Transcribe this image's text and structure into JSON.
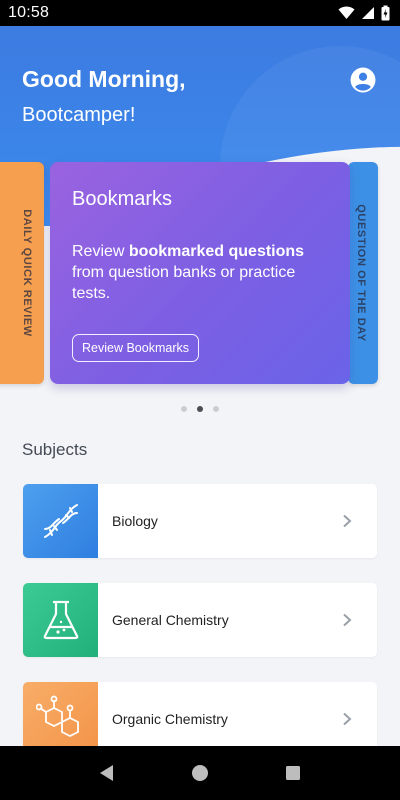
{
  "status": {
    "time": "10:58",
    "icons": [
      "wifi-icon",
      "signal-icon",
      "battery-charging-icon"
    ]
  },
  "header": {
    "greeting": "Good Morning,",
    "name": "Bootcamper!",
    "profile_icon": "account-circle-icon"
  },
  "carousel": {
    "left_card_label": "DAILY QUICK REVIEW",
    "main_card": {
      "title": "Bookmarks",
      "desc_part1": "Review ",
      "desc_bold1": "bookmarked questions",
      "desc_part2": " from question banks or practice tests.",
      "button_label": "Review Bookmarks"
    },
    "right_card_label": "QUESTION OF THE DAY",
    "page_count": 3,
    "active_index": 1
  },
  "subjects": {
    "title": "Subjects",
    "items": [
      {
        "label": "Biology",
        "icon": "dna-icon",
        "color": "#3d8ce6"
      },
      {
        "label": "General Chemistry",
        "icon": "flask-icon",
        "color": "#2dbd86"
      },
      {
        "label": "Organic Chemistry",
        "icon": "molecule-icon",
        "color": "#f7a35c"
      }
    ]
  },
  "colors": {
    "hero_blue": "#3d7be0",
    "card_purple": "#8a60e2",
    "card_orange": "#f6a04f",
    "card_blue": "#3c91e6"
  },
  "navbar": {
    "icons": [
      "back-icon",
      "home-icon",
      "recents-icon"
    ]
  }
}
